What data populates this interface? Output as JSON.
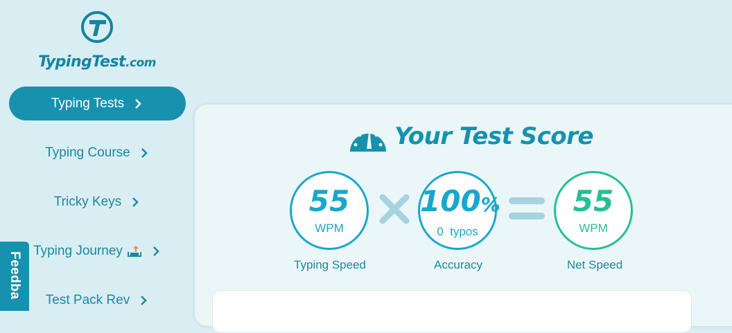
{
  "brand": {
    "name": "TypingTest",
    "tld": ".com"
  },
  "sidebar": {
    "items": [
      {
        "label": "Typing Tests"
      },
      {
        "label": "Typing Course"
      },
      {
        "label": "Tricky Keys"
      },
      {
        "label": "Typing Journey"
      },
      {
        "label": "Test Pack Rev"
      }
    ]
  },
  "feedback": {
    "label": "Feedba"
  },
  "score": {
    "title": "Your Test Score",
    "typing_speed": {
      "value": "55",
      "unit": "WPM",
      "caption": "Typing Speed"
    },
    "accuracy": {
      "value": "100",
      "suffix": "%",
      "detail": "0  typos",
      "caption": "Accuracy"
    },
    "net_speed": {
      "value": "55",
      "unit": "WPM",
      "caption": "Net Speed"
    }
  },
  "colors": {
    "accent": "#1791ae",
    "speed": "#18a7cc",
    "net": "#24bf95",
    "operator": "#a6d3df"
  },
  "icons": [
    "logo-t-icon",
    "chevron-right-icon",
    "upload-icon",
    "speedometer-icon",
    "multiply-icon",
    "equals-icon"
  ]
}
